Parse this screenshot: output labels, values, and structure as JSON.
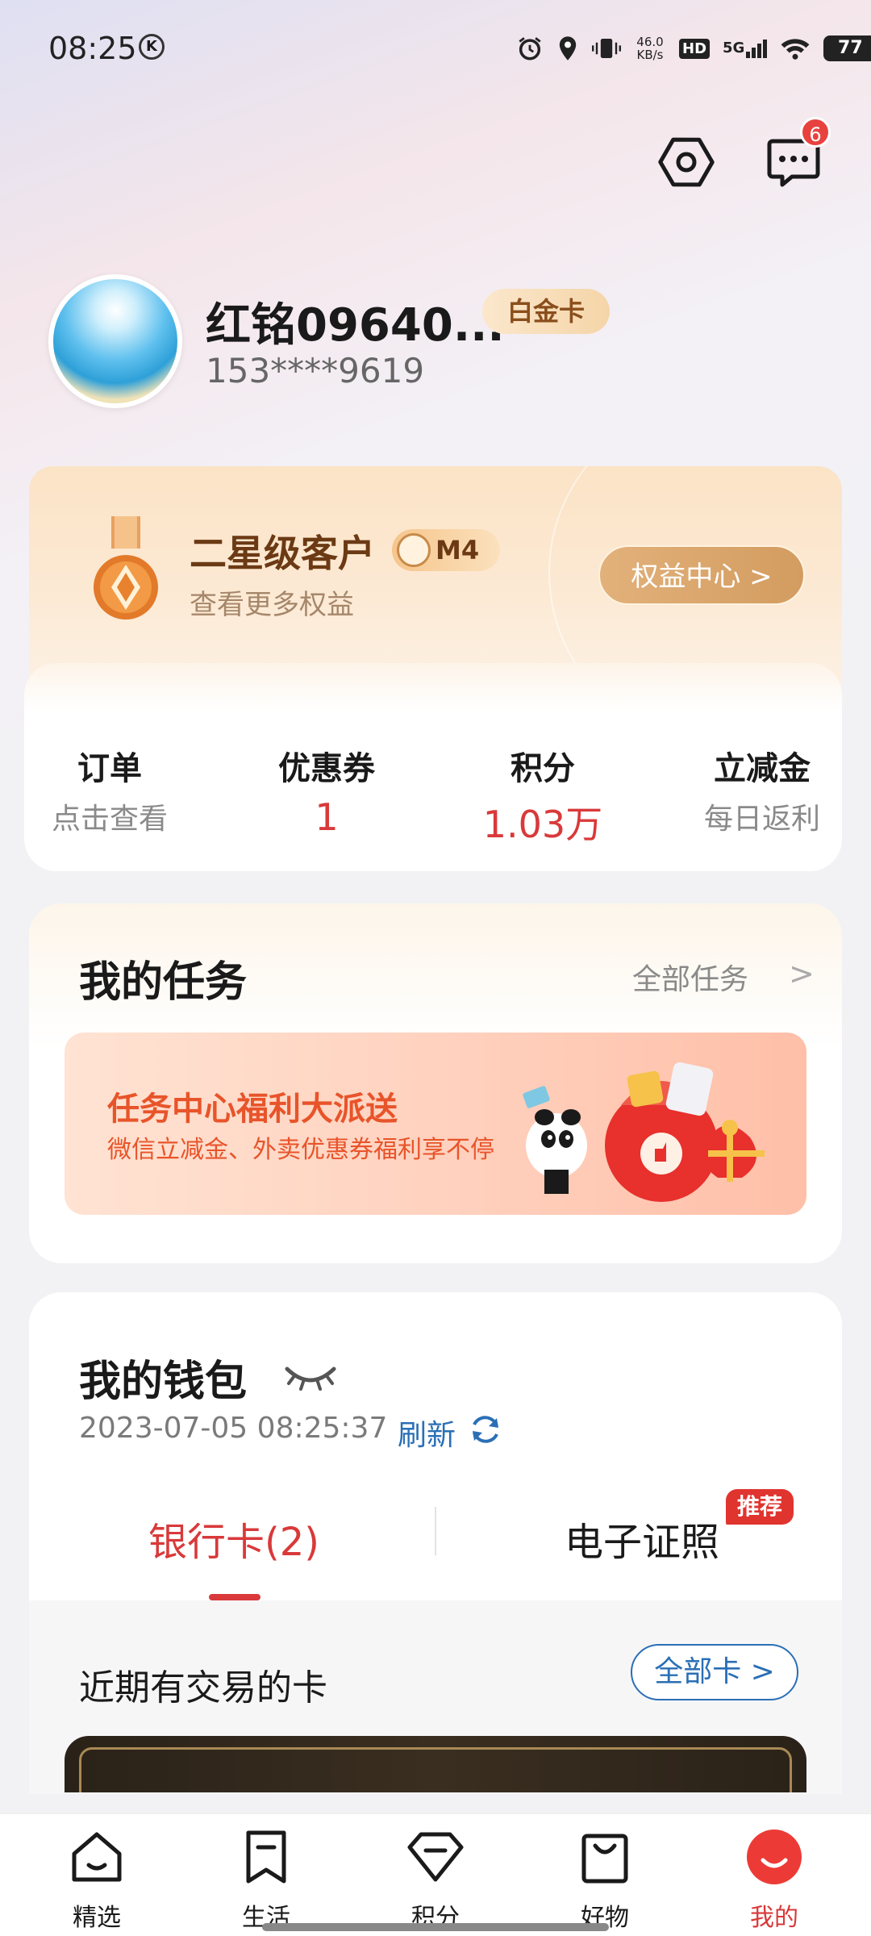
{
  "status_bar": {
    "time": "08:25",
    "k_icon": "K",
    "net_speed": "46.0\nKB/s",
    "hd": "HD",
    "network": "5G",
    "battery": "77"
  },
  "header": {
    "message_badge": "6"
  },
  "profile": {
    "name": "红铭09640...",
    "tier": "白金卡",
    "phone": "153****9619"
  },
  "member": {
    "level": "二星级客户",
    "badge": "M4",
    "subtitle": "查看更多权益",
    "rights_button": "权益中心 >"
  },
  "stats": [
    {
      "label": "订单",
      "value": "点击查看",
      "style": "gray"
    },
    {
      "label": "优惠券",
      "value": "1",
      "style": "red"
    },
    {
      "label": "积分",
      "value": "1.03万",
      "style": "red"
    },
    {
      "label": "立减金",
      "value": "每日返利",
      "style": "gray"
    }
  ],
  "tasks": {
    "title": "我的任务",
    "all_label": "全部任务",
    "chevron": ">",
    "banner_title": "任务中心福利大派送",
    "banner_sub": "微信立减金、外卖优惠券福利享不停"
  },
  "wallet": {
    "title": "我的钱包",
    "timestamp": "2023-07-05 08:25:37",
    "refresh": "刷新",
    "tab_bank": "银行卡(2)",
    "tab_cert": "电子证照",
    "rec_badge": "推荐",
    "recent_title": "近期有交易的卡",
    "all_cards": "全部卡 >"
  },
  "nav": [
    {
      "label": "精选",
      "icon": "home-icon"
    },
    {
      "label": "生活",
      "icon": "bookmark-icon"
    },
    {
      "label": "积分",
      "icon": "diamond-icon"
    },
    {
      "label": "好物",
      "icon": "bag-icon"
    },
    {
      "label": "我的",
      "icon": "profile-smile-icon",
      "active": true
    }
  ],
  "colors": {
    "accent_red": "#d9393a",
    "link_blue": "#2a6fb5",
    "gold": "#d39c60"
  }
}
